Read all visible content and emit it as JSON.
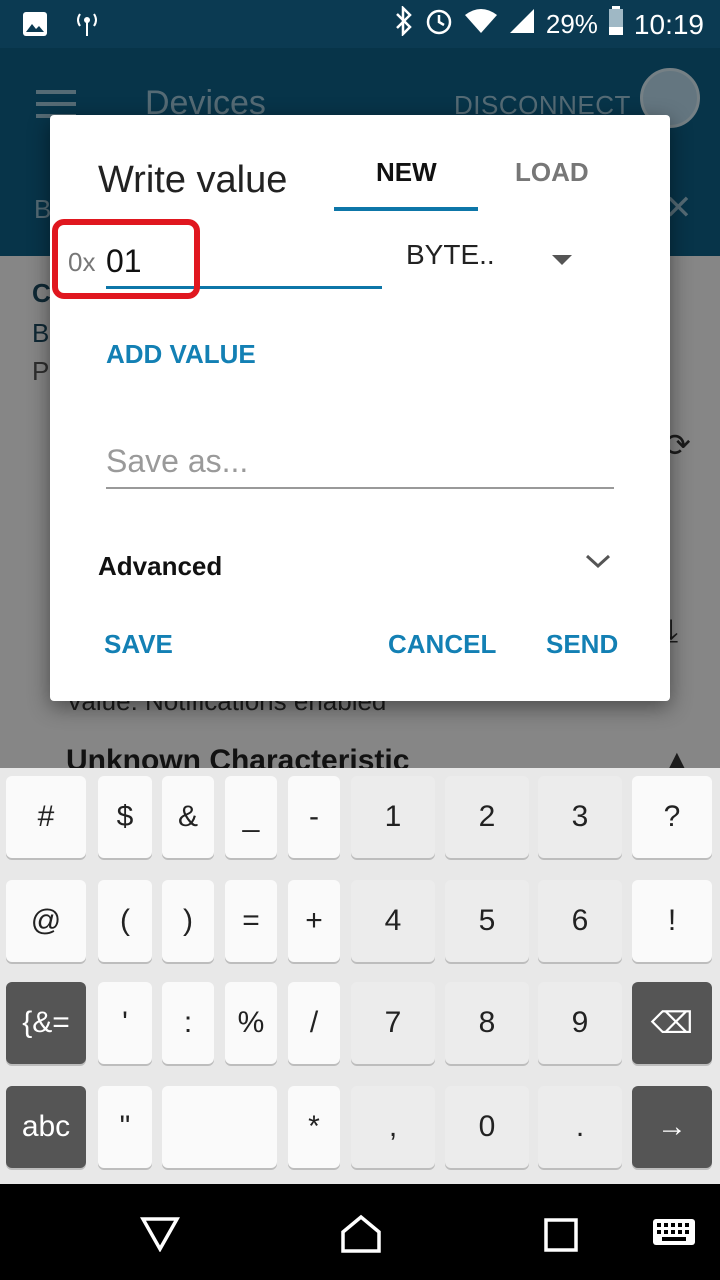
{
  "status_bar": {
    "battery": "29%",
    "time": "10:19",
    "icons": [
      "image-icon",
      "signal-tower-icon",
      "bluetooth-icon",
      "alarm-icon",
      "wifi-icon",
      "cell-signal-icon",
      "battery-icon"
    ]
  },
  "app_bar": {
    "title": "Devices",
    "disconnect": "DISCONNECT",
    "sub_left": "B",
    "sub_right": "✕"
  },
  "background": {
    "c1": "C",
    "c2": "B",
    "c3": "P",
    "value_line": "Value: Notifications enabled",
    "unknown": "Unknown Characteristic"
  },
  "dialog": {
    "title": "Write value",
    "tabs": [
      "NEW",
      "LOAD"
    ],
    "prefix": "0x",
    "value": "01",
    "type": "BYTE..",
    "add_value": "ADD VALUE",
    "saveas_placeholder": "Save as...",
    "advanced": "Advanced",
    "buttons": {
      "save": "SAVE",
      "cancel": "CANCEL",
      "send": "SEND"
    }
  },
  "keyboard": {
    "rows": [
      [
        "#",
        "$",
        "&",
        "_",
        "-",
        "1",
        "2",
        "3",
        "?"
      ],
      [
        "@",
        "(",
        ")",
        "=",
        "+",
        "4",
        "5",
        "6",
        "!"
      ],
      [
        "{&=",
        "'",
        ":",
        "%",
        "/",
        "7",
        "8",
        "9",
        "⌫"
      ],
      [
        "abc",
        "\"",
        "",
        "*",
        ",",
        "0",
        ".",
        "→"
      ]
    ]
  },
  "colors": {
    "accent": "#1380b4",
    "appbar": "#0d5f86",
    "highlight": "#e0171f"
  }
}
